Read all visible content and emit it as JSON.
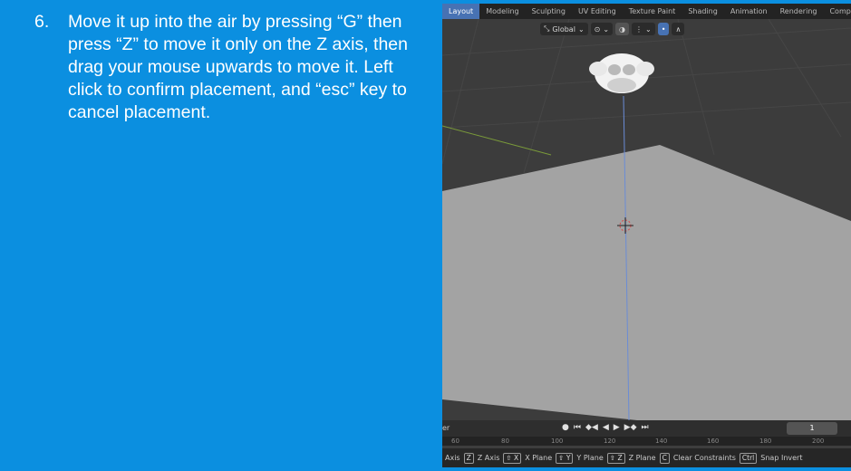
{
  "instruction": {
    "number": "6.",
    "text": "Move it up into the air by pressing “G” then press “Z” to move it only on the Z axis, then drag your mouse upwards to move it. Left click to confirm placement, and “esc” key to cancel placement."
  },
  "blender": {
    "workspace_tabs": [
      "Layout",
      "Modeling",
      "Sculpting",
      "UV Editing",
      "Texture Paint",
      "Shading",
      "Animation",
      "Rendering",
      "Comp"
    ],
    "active_tab": "Layout",
    "header": {
      "orientation": "Global"
    },
    "timeline": {
      "left_label": "er",
      "current_frame": "1",
      "ruler": [
        "60",
        "80",
        "100",
        "120",
        "140",
        "160",
        "180",
        "200"
      ]
    },
    "status_bar": {
      "lead": "Axis",
      "items": [
        {
          "keys": "Z",
          "label": "Z Axis"
        },
        {
          "keys": "⇧ X",
          "label": "X Plane"
        },
        {
          "keys": "⇧ Y",
          "label": "Y Plane"
        },
        {
          "keys": "⇧ Z",
          "label": "Z Plane"
        },
        {
          "keys": "C",
          "label": "Clear Constraints"
        },
        {
          "keys": "Ctrl",
          "label": "Snap Invert"
        }
      ]
    },
    "colors": {
      "active_tab": "#4772b3",
      "slide_background": "#0b8fe0",
      "z_axis": "#6a8cd6",
      "x_axis": "#a03a3a",
      "y_axis": "#7a9a3a"
    }
  }
}
